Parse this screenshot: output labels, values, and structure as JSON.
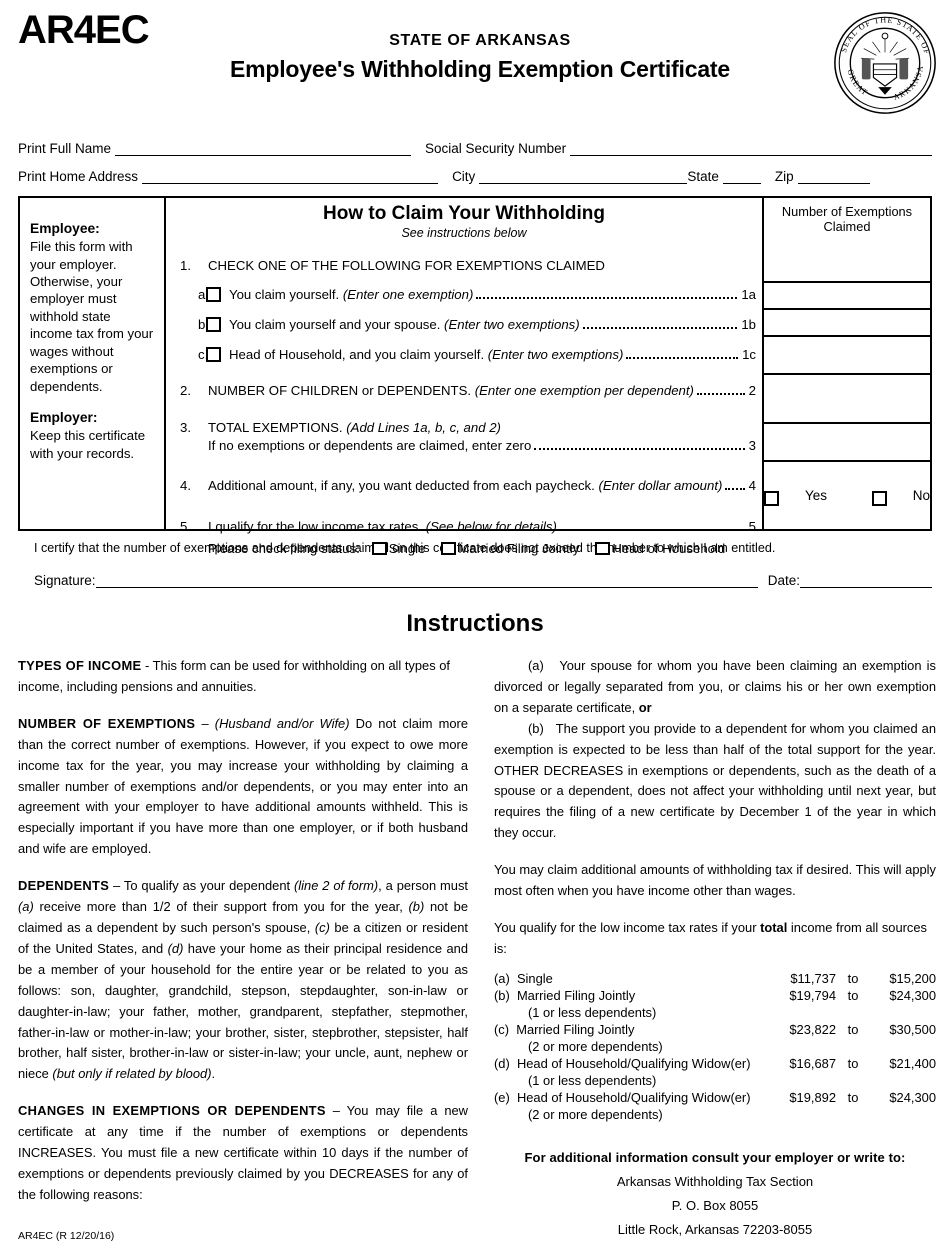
{
  "header": {
    "form_code": "AR4EC",
    "state_line": "STATE OF ARKANSAS",
    "main_title": "Employee's Withholding Exemption Certificate",
    "seal_text": "GREAT SEAL OF THE STATE OF ARKANSAS"
  },
  "identity": {
    "print_full_name": "Print Full Name",
    "social_security_number": "Social Security Number",
    "print_home_address": "Print Home Address",
    "city": "City",
    "state": "State",
    "zip": "Zip"
  },
  "sidebar": {
    "employee_heading": "Employee:",
    "employee_text": "File this form with your employer. Otherwise, your employer must withhold state income tax from your wages without exemptions or dependents.",
    "employer_heading": "Employer:",
    "employer_text": "Keep this certificate with your records."
  },
  "claim": {
    "heading": "How to Claim Your Withholding",
    "subheading": "See instructions below",
    "right_header": "Number of Exemptions Claimed",
    "line1_num": "1.",
    "line1_text": "CHECK ONE OF THE FOLLOWING FOR EXEMPTIONS CLAIMED",
    "line1a_letter": "a.",
    "line1a_text": "You claim yourself.",
    "line1a_italic": "(Enter one exemption)",
    "line1a_ref": "1a",
    "line1b_letter": "b.",
    "line1b_text": "You claim yourself and your spouse.",
    "line1b_italic": "(Enter two exemptions)",
    "line1b_ref": "1b",
    "line1c_letter": "c.",
    "line1c_text": "Head of Household, and you claim yourself.",
    "line1c_italic": "(Enter two exemptions)",
    "line1c_ref": "1c",
    "line2_num": "2.",
    "line2_text": "NUMBER OF CHILDREN or DEPENDENTS.",
    "line2_italic": "(Enter one exemption per dependent)",
    "line2_ref": "2",
    "line3_num": "3.",
    "line3_text": "TOTAL EXEMPTIONS.",
    "line3_italic": "(Add Lines 1a, b, c, and 2)",
    "line3_text2": "If no exemptions or dependents are claimed, enter zero",
    "line3_ref": "3",
    "line4_num": "4.",
    "line4_text": "Additional amount, if any, you want deducted from each paycheck.",
    "line4_italic": "(Enter dollar amount)",
    "line4_ref": "4",
    "line5_num": "5.",
    "line5_text": "I qualify for the low income tax rates.",
    "line5_italic": "(See below for details)",
    "line5_ref": "5",
    "filing_status_label": "Please check filing status:",
    "filing_single": "Single",
    "filing_mfj": "Married Filing Jointly",
    "filing_hoh": "Head of Household",
    "yes_label": "Yes",
    "no_label": "No"
  },
  "certify": {
    "text": "I certify that the number of exemptions and dependents claimed on this certificate does not exceed the number to which I am entitled.",
    "signature_label": "Signature:",
    "date_label": "Date:"
  },
  "instructions": {
    "title": "Instructions",
    "types_of_income_hd": "TYPES OF INCOME",
    "types_of_income_body": " - This form can be used for withholding on all types of income, including pensions and annuities.",
    "number_of_exemptions_hd": "NUMBER OF EXEMPTIONS",
    "number_of_exemptions_dash": " – ",
    "number_of_exemptions_italic": "(Husband and/or Wife)",
    "number_of_exemptions_body": " Do not claim more than the correct number of exemptions. However, if you expect to owe more income tax for the year, you may increase your withholding by claiming a smaller number of exemptions and/or dependents, or you may enter into an agreement with your employer to have additional amounts withheld. This is especially important if you have more than one employer, or if both husband and wife are employed.",
    "dependents_hd": "DEPENDENTS",
    "dependents_p1": " – To qualify as your dependent ",
    "dependents_i1": "(line 2 of form)",
    "dependents_p2": ", a person must ",
    "dependents_i2": "(a)",
    "dependents_p3": " receive more than 1/2 of their support from you for the year, ",
    "dependents_i3": "(b)",
    "dependents_p4": " not be claimed as a dependent by such person's spouse, ",
    "dependents_i4": "(c)",
    "dependents_p5": " be a citizen or resident of the United States, and ",
    "dependents_i5": "(d)",
    "dependents_p6": " have your home as their principal residence and be a member of your household for the entire year or be related to you as follows: son, daughter, grandchild, stepson, stepdaughter, son-in-law or daughter-in-law; your father, mother, grandparent, stepfather, stepmother, father-in-law or mother-in-law; your brother, sister, stepbrother, stepsister, half brother, half sister, brother-in-law or sister-in-law; your uncle, aunt, nephew or niece ",
    "dependents_i6": "(but only if related by blood)",
    "dependents_p7": ".",
    "changes_hd": "CHANGES IN EXEMPTIONS OR DEPENDENTS",
    "changes_body": " – You may file a new certificate at any time if the number of exemptions or dependents INCREASES. You must file a new certificate within 10 days if the number of exemptions or dependents previously claimed by you DECREASES for any of the following reasons:",
    "reason_a_marker": "(a)",
    "reason_a_text": "Your spouse for whom you have been claiming an exemption is divorced or legally separated from you, or claims his or her own exemption on a separate certificate, ",
    "reason_a_bold": "or",
    "reason_b_marker": "(b)",
    "reason_b_text": "The support you provide to a dependent for whom you claimed an exemption is expected to be less than half of the total support for the year. OTHER DECREASES in exemptions or dependents, such as the death of a spouse or a dependent, does not affect your withholding until next year, but requires the filing of a new certificate by December 1 of the year in which they occur.",
    "additional_amounts": "You may claim additional amounts of withholding tax if desired. This will apply most often when you have income other than wages.",
    "qualify_p1": "You qualify for the low income tax rates if your ",
    "qualify_bold": "total",
    "qualify_p2": " income from all sources is:"
  },
  "income_table": {
    "rows": [
      {
        "marker": "(a)",
        "label": "Single",
        "sub": "",
        "from": "$11,737",
        "to": "to",
        "upper": "$15,200"
      },
      {
        "marker": "(b)",
        "label": "Married Filing Jointly",
        "sub": "(1 or less dependents)",
        "from": "$19,794",
        "to": "to",
        "upper": "$24,300"
      },
      {
        "marker": "(c)",
        "label": "Married Filing Jointly",
        "sub": "(2 or more dependents)",
        "from": "$23,822",
        "to": "to",
        "upper": "$30,500"
      },
      {
        "marker": "(d)",
        "label": "Head of Household/Qualifying Widow(er)",
        "sub": "(1 or less dependents)",
        "from": "$16,687",
        "to": "to",
        "upper": "$21,400"
      },
      {
        "marker": "(e)",
        "label": "Head of Household/Qualifying Widow(er)",
        "sub": "(2 or more dependents)",
        "from": "$19,892",
        "to": "to",
        "upper": "$24,300"
      }
    ]
  },
  "contact": {
    "heading": "For additional information consult your employer or write to:",
    "line1": "Arkansas Withholding Tax Section",
    "line2": "P. O. Box 8055",
    "line3": "Little Rock, Arkansas  72203-8055"
  },
  "footer": {
    "revision": "AR4EC (R 12/20/16)"
  }
}
